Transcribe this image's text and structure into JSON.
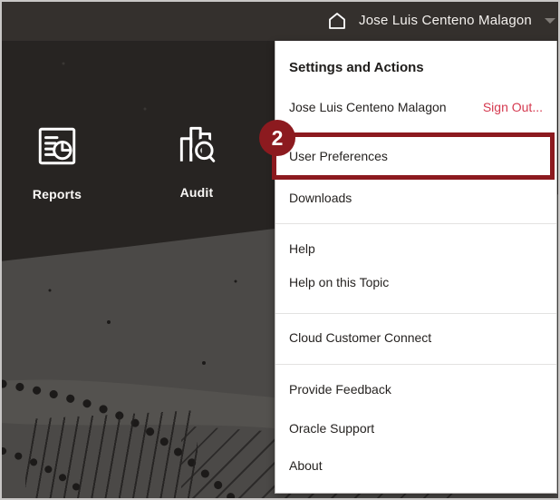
{
  "topbar": {
    "user_name": "Jose Luis Centeno Malagon"
  },
  "desktop": {
    "tiles": [
      {
        "label": "Reports"
      },
      {
        "label": "Audit"
      }
    ]
  },
  "menu": {
    "header": "Settings and Actions",
    "user_name": "Jose Luis Centeno Malagon",
    "sign_out_label": "Sign Out...",
    "items": [
      "User Preferences",
      "Downloads",
      "Help",
      "Help on this Topic",
      "Cloud Customer Connect",
      "Provide Feedback",
      "Oracle Support",
      "About"
    ]
  },
  "annotation": {
    "step": "2",
    "highlighted_item": "User Preferences"
  },
  "icons": [
    "home-icon",
    "chevron-down-icon",
    "reports-icon",
    "audit-icon"
  ],
  "colors": {
    "topbar_bg": "#34302d",
    "canvas_dark": "#272422",
    "canvas_mid_gray": "#4b4947",
    "menu_bg": "#ffffff",
    "menu_text": "#262321",
    "sign_out_red": "#d5394f",
    "annotation_red": "#8c1a1f"
  }
}
